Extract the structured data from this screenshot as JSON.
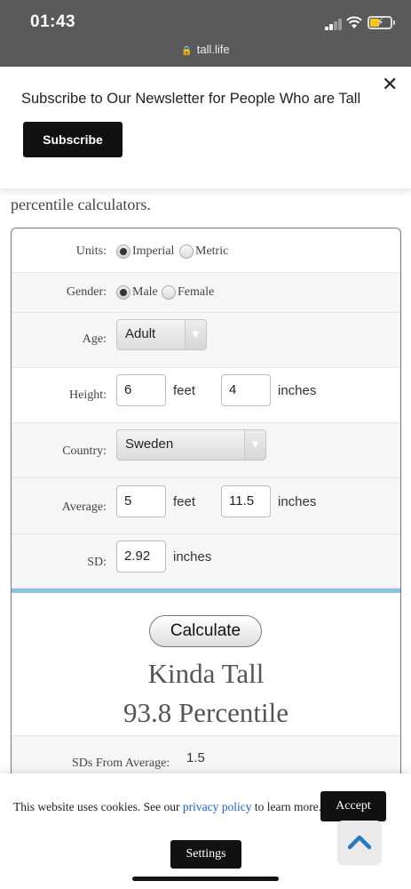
{
  "status_bar": {
    "time": "01:43",
    "url": "tall.life"
  },
  "newsletter": {
    "text": "Subscribe to Our Newsletter for People Who are Tall",
    "subscribe_label": "Subscribe",
    "close_symbol": "✕"
  },
  "article": {
    "fragment": "percentile calculators."
  },
  "calculator": {
    "units": {
      "label": "Units:",
      "options": [
        "Imperial",
        "Metric"
      ],
      "selected": "Imperial"
    },
    "gender": {
      "label": "Gender:",
      "options": [
        "Male",
        "Female"
      ],
      "selected": "Male"
    },
    "age": {
      "label": "Age:",
      "value": "Adult"
    },
    "height": {
      "label": "Height:",
      "feet": "6",
      "feet_unit": "feet",
      "inches": "4",
      "inches_unit": "inches"
    },
    "country": {
      "label": "Country:",
      "value": "Sweden"
    },
    "average": {
      "label": "Average:",
      "feet": "5",
      "feet_unit": "feet",
      "inches": "11.5",
      "inches_unit": "inches"
    },
    "sd": {
      "label": "SD:",
      "value": "2.92",
      "unit": "inches"
    },
    "calculate_label": "Calculate",
    "result_category": "Kinda Tall",
    "result_percentile": "93.8 Percentile",
    "sds_from_average": {
      "label": "SDs From Average:",
      "value": "1.5"
    }
  },
  "cookie_banner": {
    "text_before": "This website uses cookies. See our ",
    "link_text": "privacy policy",
    "text_after": " to learn more.",
    "accept_label": "Accept",
    "settings_label": "Settings"
  },
  "icons": {
    "lock": "lock-icon",
    "close": "close-icon",
    "scroll_top": "chevron-up-icon",
    "signal": "cellular-signal-icon",
    "wifi": "wifi-icon",
    "battery": "battery-charging-icon"
  },
  "colors": {
    "status_bar": "#5a5a5a",
    "divider": "#8cc4e0",
    "link": "#1e5fb8",
    "chevron": "#2a7ac0",
    "battery": "#f4c51c"
  }
}
